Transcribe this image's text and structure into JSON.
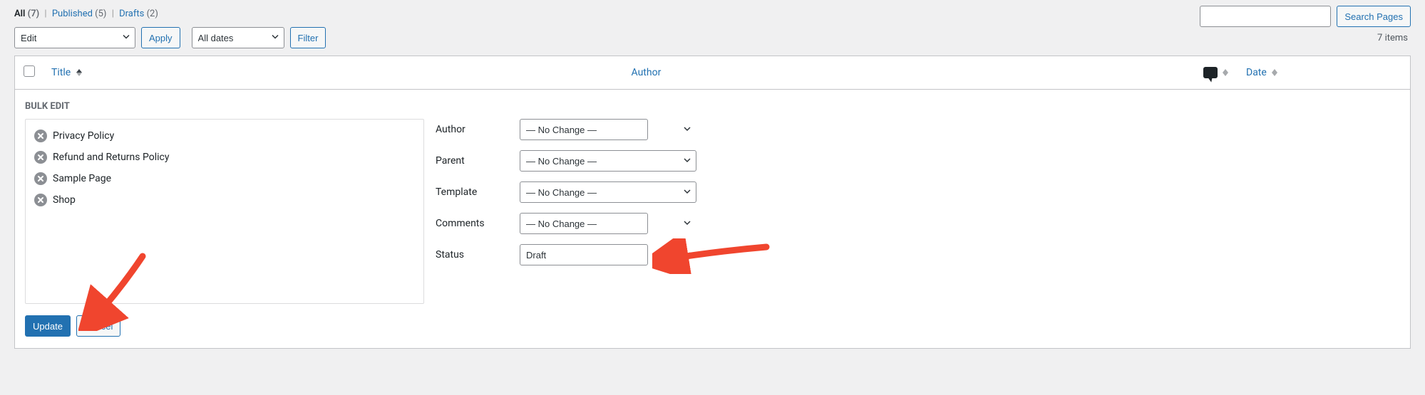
{
  "filters_tabs": {
    "all": {
      "label": "All",
      "count": "(7)"
    },
    "published": {
      "label": "Published",
      "count": "(5)"
    },
    "drafts": {
      "label": "Drafts",
      "count": "(2)"
    }
  },
  "search": {
    "placeholder": "",
    "button": "Search Pages"
  },
  "bulk_action_select": "Edit",
  "apply_label": "Apply",
  "date_filter_select": "All dates",
  "filter_label": "Filter",
  "items_count": "7 items",
  "columns": {
    "title": "Title",
    "author": "Author",
    "date": "Date"
  },
  "bulk_edit": {
    "legend": "BULK EDIT",
    "items": [
      "Privacy Policy",
      "Refund and Returns Policy",
      "Sample Page",
      "Shop"
    ],
    "fields": {
      "author": {
        "label": "Author",
        "value": "— No Change —"
      },
      "parent": {
        "label": "Parent",
        "value": "— No Change —"
      },
      "template": {
        "label": "Template",
        "value": "— No Change —"
      },
      "comments": {
        "label": "Comments",
        "value": "— No Change —"
      },
      "status": {
        "label": "Status",
        "value": "Draft"
      }
    },
    "update": "Update",
    "cancel": "Cancel"
  },
  "colors": {
    "accent": "#2271b1",
    "annotation": "#f0452e"
  }
}
